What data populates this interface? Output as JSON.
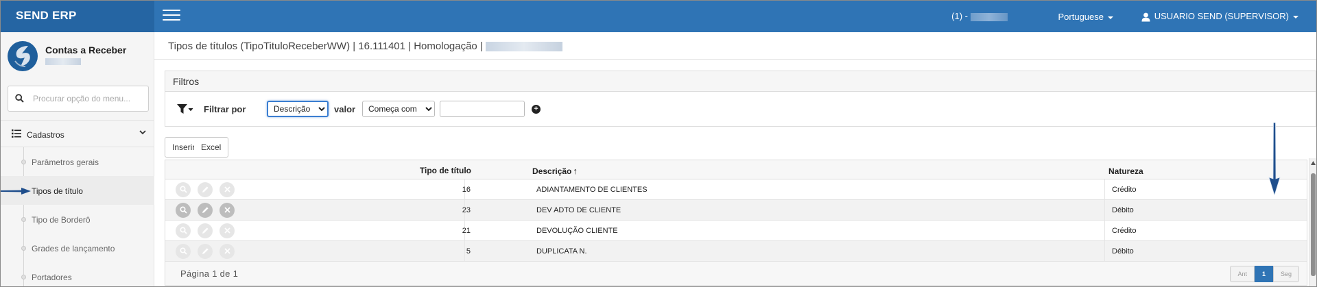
{
  "header": {
    "brand": "SEND ERP",
    "company_prefix": "(1) -",
    "language": "Portuguese",
    "user": "USUARIO SEND (SUPERVISOR)"
  },
  "sidebar": {
    "module_title": "Contas a Receber",
    "search_placeholder": "Procurar opção do menu...",
    "section_label": "Cadastros",
    "items": [
      {
        "label": "Parâmetros gerais"
      },
      {
        "label": "Tipos de título"
      },
      {
        "label": "Tipo de Borderô"
      },
      {
        "label": "Grades de lançamento"
      },
      {
        "label": "Portadores"
      }
    ],
    "active_index": 1
  },
  "main": {
    "page_title": "Tipos de títulos (TipoTituloReceberWW) | 16.111401 | Homologação |",
    "filters": {
      "heading": "Filtros",
      "filter_by_label": "Filtrar por",
      "field_value": "Descrição",
      "value_label": "valor",
      "operator_value": "Começa com",
      "search_value": ""
    },
    "buttons": {
      "insert": "Inserir",
      "excel": "Excel"
    },
    "grid": {
      "columns": {
        "tipo": "Tipo de título",
        "descricao": "Descrição",
        "natureza": "Natureza"
      },
      "sort_indicator": "↑",
      "rows": [
        {
          "tipo": "16",
          "descricao": "ADIANTAMENTO DE CLIENTES",
          "natureza": "Crédito"
        },
        {
          "tipo": "23",
          "descricao": "DEV ADTO DE CLIENTE",
          "natureza": "Débito"
        },
        {
          "tipo": "21",
          "descricao": "DEVOLUÇÃO CLIENTE",
          "natureza": "Crédito"
        },
        {
          "tipo": "5",
          "descricao": "DUPLICATA N.",
          "natureza": "Débito"
        }
      ]
    },
    "pager": {
      "text": "Página 1 de 1",
      "prev": "Ant",
      "current": "1",
      "next": "Seg"
    }
  },
  "icons": {
    "menu": "hamburger-icon",
    "user": "user-icon",
    "search": "search-icon",
    "section": "list-icon",
    "filter": "funnel-icon",
    "add": "plus-circle-icon",
    "row_actions": [
      "magnifier-icon",
      "pencil-icon",
      "close-icon"
    ]
  },
  "colors": {
    "topbar": "#2f74b5",
    "brand_bg": "#2565a3",
    "annotation_arrow": "#1f4e8c"
  }
}
